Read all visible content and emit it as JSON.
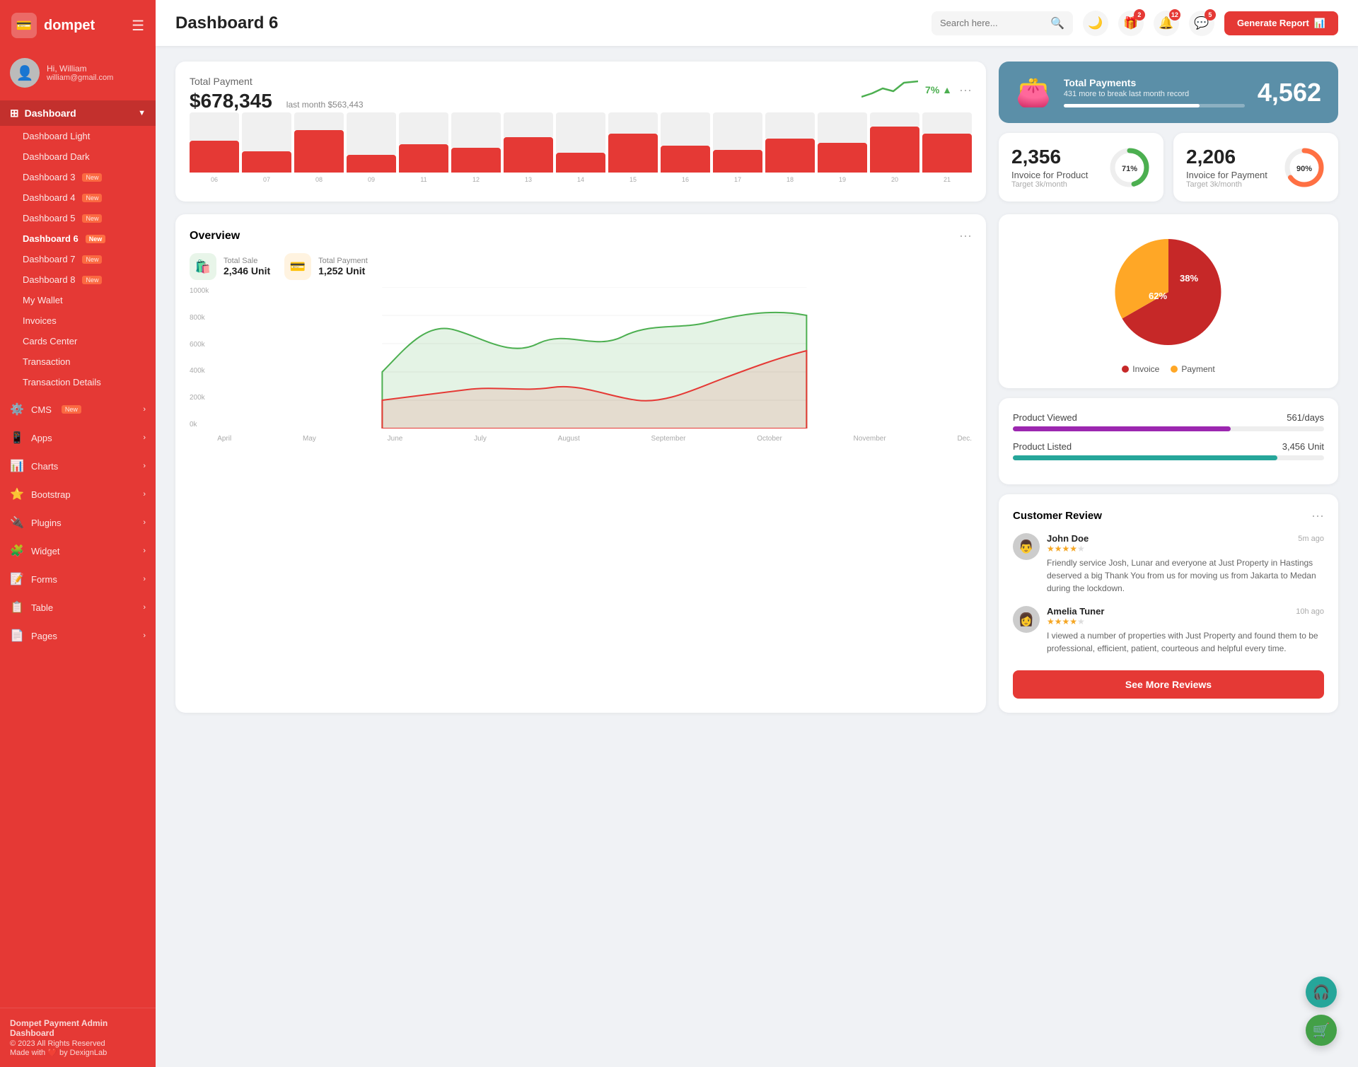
{
  "sidebar": {
    "logo": "dompet",
    "logo_icon": "💳",
    "hamburger": "☰",
    "user": {
      "hi": "Hi,",
      "name": "William",
      "email": "william@gmail.com",
      "avatar": "👤"
    },
    "dashboard_group": "Dashboard",
    "dashboard_items": [
      {
        "label": "Dashboard Light",
        "badge": null
      },
      {
        "label": "Dashboard Dark",
        "badge": null
      },
      {
        "label": "Dashboard 3",
        "badge": "New"
      },
      {
        "label": "Dashboard 4",
        "badge": "New"
      },
      {
        "label": "Dashboard 5",
        "badge": "New"
      },
      {
        "label": "Dashboard 6",
        "badge": "New",
        "active": true
      },
      {
        "label": "Dashboard 7",
        "badge": "New"
      },
      {
        "label": "Dashboard 8",
        "badge": "New"
      },
      {
        "label": "My Wallet",
        "badge": null
      },
      {
        "label": "Invoices",
        "badge": null
      },
      {
        "label": "Cards Center",
        "badge": null
      },
      {
        "label": "Transaction",
        "badge": null
      },
      {
        "label": "Transaction Details",
        "badge": null
      }
    ],
    "menu_items": [
      {
        "icon": "⚙️",
        "label": "CMS",
        "badge": "New",
        "arrow": "›"
      },
      {
        "icon": "📱",
        "label": "Apps",
        "arrow": "›"
      },
      {
        "icon": "📊",
        "label": "Charts",
        "arrow": "›"
      },
      {
        "icon": "⭐",
        "label": "Bootstrap",
        "arrow": "›"
      },
      {
        "icon": "🔌",
        "label": "Plugins",
        "arrow": "›"
      },
      {
        "icon": "🧩",
        "label": "Widget",
        "arrow": "›"
      },
      {
        "icon": "📝",
        "label": "Forms",
        "arrow": "›"
      },
      {
        "icon": "📋",
        "label": "Table",
        "arrow": "›"
      },
      {
        "icon": "📄",
        "label": "Pages",
        "arrow": "›"
      }
    ],
    "footer": {
      "brand": "Dompet Payment Admin Dashboard",
      "copy": "© 2023 All Rights Reserved",
      "made": "Made with ❤️ by DexignLab"
    }
  },
  "topbar": {
    "title": "Dashboard 6",
    "search_placeholder": "Search here...",
    "icons": [
      {
        "name": "theme-toggle",
        "symbol": "🌙",
        "badge": null
      },
      {
        "name": "gift-icon",
        "symbol": "🎁",
        "badge": "2"
      },
      {
        "name": "bell-icon",
        "symbol": "🔔",
        "badge": "12"
      },
      {
        "name": "chat-icon",
        "symbol": "💬",
        "badge": "5"
      }
    ],
    "generate_btn": "Generate Report"
  },
  "total_payment": {
    "title": "Total Payment",
    "amount": "$678,345",
    "last_month_label": "last month $563,443",
    "trend_pct": "7%",
    "trend_up": true,
    "bars": [
      {
        "label": "06",
        "bg": 85,
        "red": 45
      },
      {
        "label": "07",
        "bg": 85,
        "red": 30
      },
      {
        "label": "08",
        "bg": 85,
        "red": 60
      },
      {
        "label": "09",
        "bg": 85,
        "red": 25
      },
      {
        "label": "11",
        "bg": 85,
        "red": 40
      },
      {
        "label": "12",
        "bg": 85,
        "red": 35
      },
      {
        "label": "13",
        "bg": 85,
        "red": 50
      },
      {
        "label": "14",
        "bg": 85,
        "red": 28
      },
      {
        "label": "15",
        "bg": 85,
        "red": 55
      },
      {
        "label": "16",
        "bg": 85,
        "red": 38
      },
      {
        "label": "17",
        "bg": 85,
        "red": 32
      },
      {
        "label": "18",
        "bg": 85,
        "red": 48
      },
      {
        "label": "19",
        "bg": 85,
        "red": 42
      },
      {
        "label": "20",
        "bg": 85,
        "red": 65
      },
      {
        "label": "21",
        "bg": 85,
        "red": 55
      }
    ]
  },
  "total_payments_blue": {
    "icon": "👛",
    "label": "Total Payments",
    "sub": "431 more to break last month record",
    "number": "4,562",
    "progress": 75
  },
  "invoice_product": {
    "number": "2,356",
    "label": "Invoice for Product",
    "target": "Target 3k/month",
    "pct": 71,
    "color": "#4caf50"
  },
  "invoice_payment": {
    "number": "2,206",
    "label": "Invoice for Payment",
    "target": "Target 3k/month",
    "pct": 90,
    "color": "#ff7043"
  },
  "overview": {
    "title": "Overview",
    "total_sale": {
      "label": "Total Sale",
      "value": "2,346 Unit"
    },
    "total_payment": {
      "label": "Total Payment",
      "value": "1,252 Unit"
    },
    "y_labels": [
      "1000k",
      "800k",
      "600k",
      "400k",
      "200k",
      "0k"
    ],
    "x_labels": [
      "April",
      "May",
      "June",
      "July",
      "August",
      "September",
      "October",
      "November",
      "Dec."
    ]
  },
  "pie_chart": {
    "invoice_pct": 62,
    "payment_pct": 38,
    "invoice_color": "#c62828",
    "payment_color": "#ffa726",
    "legend": [
      {
        "label": "Invoice",
        "color": "#c62828"
      },
      {
        "label": "Payment",
        "color": "#ffa726"
      }
    ]
  },
  "product_stats": [
    {
      "label": "Product Viewed",
      "value": "561/days",
      "pct": 70,
      "color": "#9c27b0"
    },
    {
      "label": "Product Listed",
      "value": "3,456 Unit",
      "pct": 85,
      "color": "#26a69a"
    }
  ],
  "customer_review": {
    "title": "Customer Review",
    "reviews": [
      {
        "name": "John Doe",
        "avatar": "👨",
        "stars": 4,
        "time": "5m ago",
        "text": "Friendly service Josh, Lunar and everyone at Just Property in Hastings deserved a big Thank You from us for moving us from Jakarta to Medan during the lockdown."
      },
      {
        "name": "Amelia Tuner",
        "avatar": "👩",
        "stars": 4,
        "time": "10h ago",
        "text": "I viewed a number of properties with Just Property and found them to be professional, efficient, patient, courteous and helpful every time."
      }
    ],
    "see_more_label": "See More Reviews"
  },
  "float_buttons": [
    {
      "icon": "🎧",
      "color": "teal"
    },
    {
      "icon": "🛒",
      "color": "green"
    }
  ],
  "colors": {
    "primary": "#e53935",
    "sidebar_bg": "#e53935",
    "blue_card": "#5b8fa8"
  }
}
